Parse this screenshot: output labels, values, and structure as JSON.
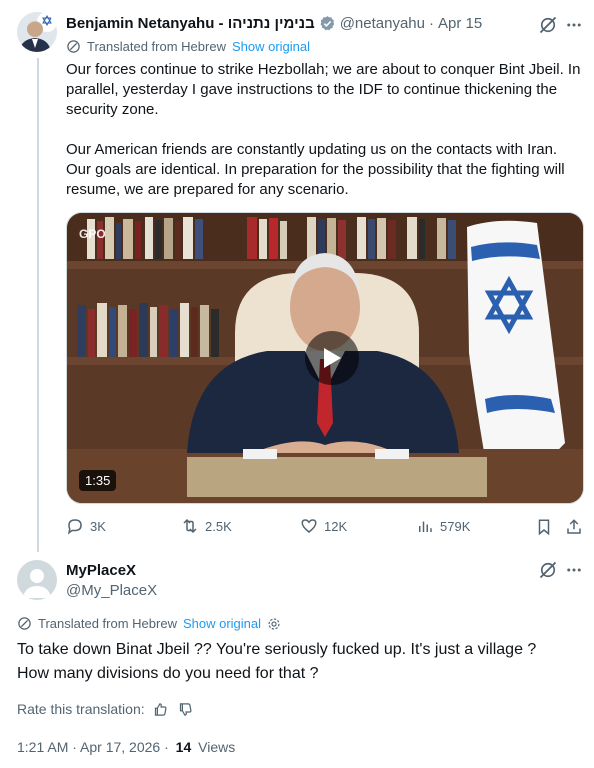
{
  "main_tweet": {
    "author_name": "Benjamin Netanyahu - בנימין נתניהו",
    "handle": "@netanyahu",
    "dot": "·",
    "date": "Apr 15",
    "translated_label": "Translated from Hebrew",
    "show_original": "Show original",
    "paragraph1": "Our forces continue to strike Hezbollah; we are about to conquer Bint Jbeil. In parallel, yesterday I gave instructions to the IDF to continue thickening the security zone.",
    "paragraph2": "Our American friends are constantly updating us on the contacts with Iran. Our goals are identical. In preparation for the possibility that the fighting will resume, we are prepared for any scenario.",
    "video": {
      "watermark": "GPO",
      "duration": "1:35"
    },
    "stats": {
      "replies": "3K",
      "reposts": "2.5K",
      "likes": "12K",
      "views": "579K"
    }
  },
  "reply_tweet": {
    "author_name": "MyPlaceX",
    "handle": "@My_PlaceX",
    "translated_label": "Translated from Hebrew",
    "show_original": "Show original",
    "text_line1": "To take down Binat Jbeil ?? You're seriously fucked up. It's just a village ?",
    "text_line2": "How many divisions do you need for that ?",
    "rate_label": "Rate this translation:",
    "time": "1:21 AM · Apr 17, 2026 ·",
    "views_count": "14",
    "views_label": "Views"
  },
  "colors": {
    "accent": "#1d9bf0",
    "muted": "#536471",
    "verified": "#829aab",
    "flag_blue": "#2b5fb0"
  },
  "icons": [
    "verified-badge-icon",
    "grok-icon",
    "more-icon",
    "translate-icon",
    "reply-icon",
    "repost-icon",
    "like-icon",
    "views-icon",
    "bookmark-icon",
    "share-icon",
    "play-icon",
    "settings-icon",
    "thumbs-up-icon",
    "thumbs-down-icon"
  ]
}
